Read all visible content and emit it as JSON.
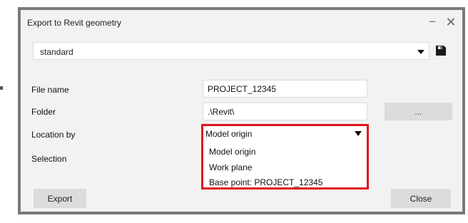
{
  "dialog": {
    "title": "Export to Revit geometry",
    "minimize_glyph": "−",
    "close_glyph": "✕"
  },
  "profile": {
    "selected": "standard",
    "save_icon": "save-icon"
  },
  "fields": {
    "file_name_label": "File name",
    "file_name_value": "PROJECT_12345",
    "folder_label": "Folder",
    "folder_value": ".\\Revit\\",
    "browse_label": "...",
    "location_label": "Location by",
    "location_selected": "Model origin",
    "selection_label": "Selection"
  },
  "location_options": [
    "Model origin",
    "Work plane",
    "Base point: PROJECT_12345"
  ],
  "buttons": {
    "export": "Export",
    "close": "Close"
  },
  "colors": {
    "highlight": "#e0151c",
    "button_bg": "#dcdcdc",
    "dialog_bg": "#f2f2f2"
  }
}
